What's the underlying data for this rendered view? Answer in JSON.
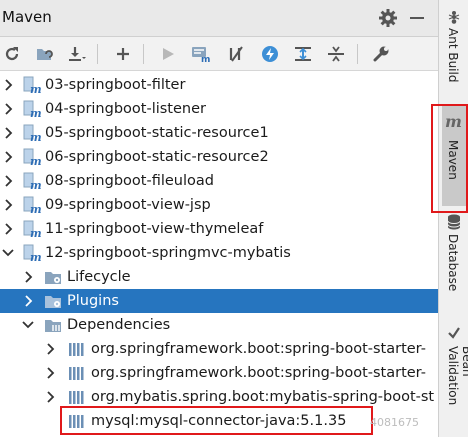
{
  "window": {
    "title": "Maven"
  },
  "toolbar": {
    "buttons": [
      {
        "icon": "reload-icon"
      },
      {
        "icon": "generate-sources-icon"
      },
      {
        "icon": "download-icon"
      },
      {
        "icon": "add-icon"
      },
      {
        "icon": "run-icon"
      },
      {
        "icon": "execute-goal-icon"
      },
      {
        "icon": "toggle-offline-icon"
      },
      {
        "icon": "skip-tests-icon"
      },
      {
        "icon": "show-dependencies-icon"
      },
      {
        "icon": "collapse-all-icon"
      },
      {
        "icon": "settings-wrench-icon"
      }
    ]
  },
  "tree": {
    "rows": [
      {
        "label": "03-springboot-filter",
        "kind": "module",
        "expanded": false
      },
      {
        "label": "04-springboot-listener",
        "kind": "module",
        "expanded": false
      },
      {
        "label": "05-springboot-static-resource1",
        "kind": "module",
        "expanded": false
      },
      {
        "label": "06-springboot-static-resource2",
        "kind": "module",
        "expanded": false
      },
      {
        "label": "08-springboot-fileuload",
        "kind": "module",
        "expanded": false
      },
      {
        "label": "09-springboot-view-jsp",
        "kind": "module",
        "expanded": false
      },
      {
        "label": "11-springboot-view-thymeleaf",
        "kind": "module",
        "expanded": false
      },
      {
        "label": "12-springboot-springmvc-mybatis",
        "kind": "module",
        "expanded": true
      },
      {
        "label": "Lifecycle",
        "kind": "folder",
        "expanded": false
      },
      {
        "label": "Plugins",
        "kind": "folder",
        "expanded": false,
        "selected": true
      },
      {
        "label": "Dependencies",
        "kind": "folder",
        "expanded": true
      },
      {
        "label": "org.springframework.boot:spring-boot-starter-",
        "kind": "dependency",
        "expanded": false
      },
      {
        "label": "org.springframework.boot:spring-boot-starter-",
        "kind": "dependency",
        "expanded": false
      },
      {
        "label": "org.mybatis.spring.boot:mybatis-spring-boot-st",
        "kind": "dependency",
        "expanded": false
      },
      {
        "label": "mysql:mysql-connector-java:5.1.35",
        "kind": "dependency",
        "expanded": null
      }
    ]
  },
  "sidebar": {
    "tabs": [
      {
        "label": "Ant Build",
        "icon": "ant-icon"
      },
      {
        "label": "Maven",
        "icon": "maven-icon",
        "active": true
      },
      {
        "label": "Database",
        "icon": "database-icon"
      },
      {
        "label": "Bean Validation",
        "icon": "bean-validation-icon"
      }
    ]
  },
  "watermark": "4081675",
  "colors": {
    "selection": "#2675bf",
    "highlight_box": "#e0191b",
    "folder": "#8aa4bd"
  }
}
